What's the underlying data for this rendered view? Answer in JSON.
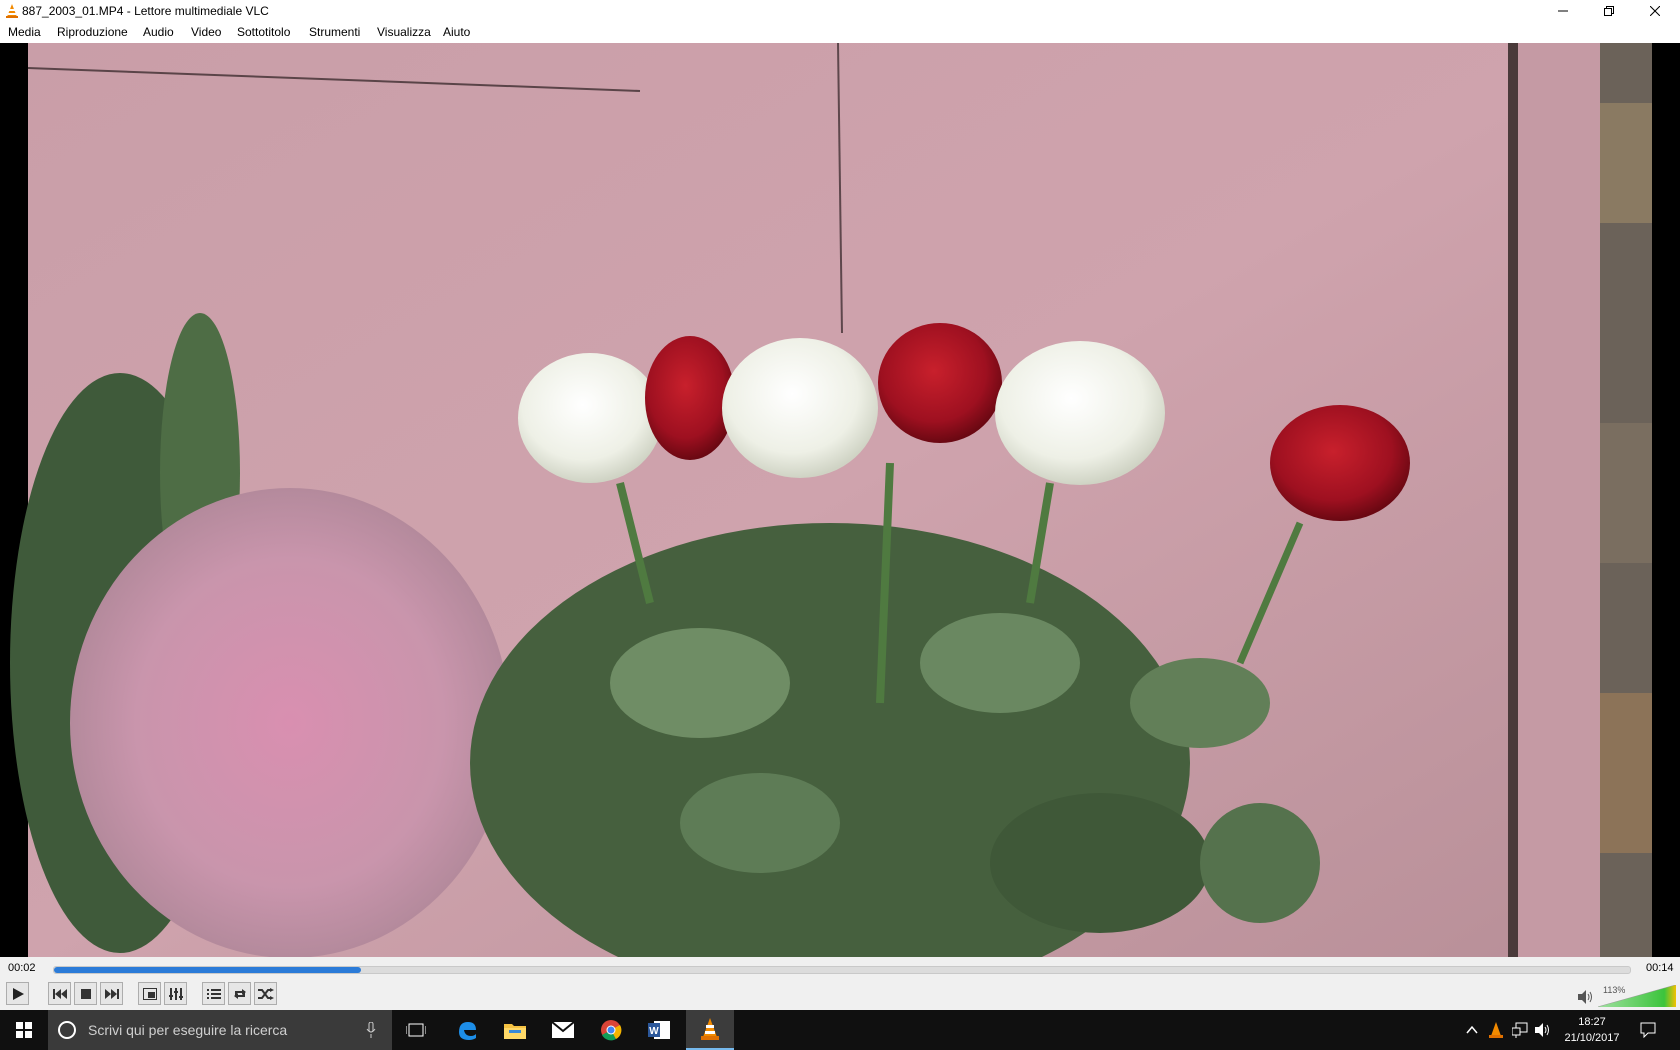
{
  "window": {
    "title": "887_2003_01.MP4 - Lettore multimediale VLC"
  },
  "menu": {
    "items": [
      "Media",
      "Riproduzione",
      "Audio",
      "Video",
      "Sottotitolo",
      "Strumenti",
      "Visualizza",
      "Aiuto"
    ]
  },
  "player": {
    "elapsed": "00:02",
    "total": "00:14",
    "progress_fraction": 0.195,
    "volume_label": "113%",
    "volume_fraction": 1.0
  },
  "taskbar": {
    "search_placeholder": "Scrivi qui per eseguire la ricerca",
    "time": "18:27",
    "date": "21/10/2017"
  },
  "colors": {
    "accent": "#2b7bd8",
    "vlc_orange": "#f28a00",
    "volume_green": "#3cc43c"
  }
}
